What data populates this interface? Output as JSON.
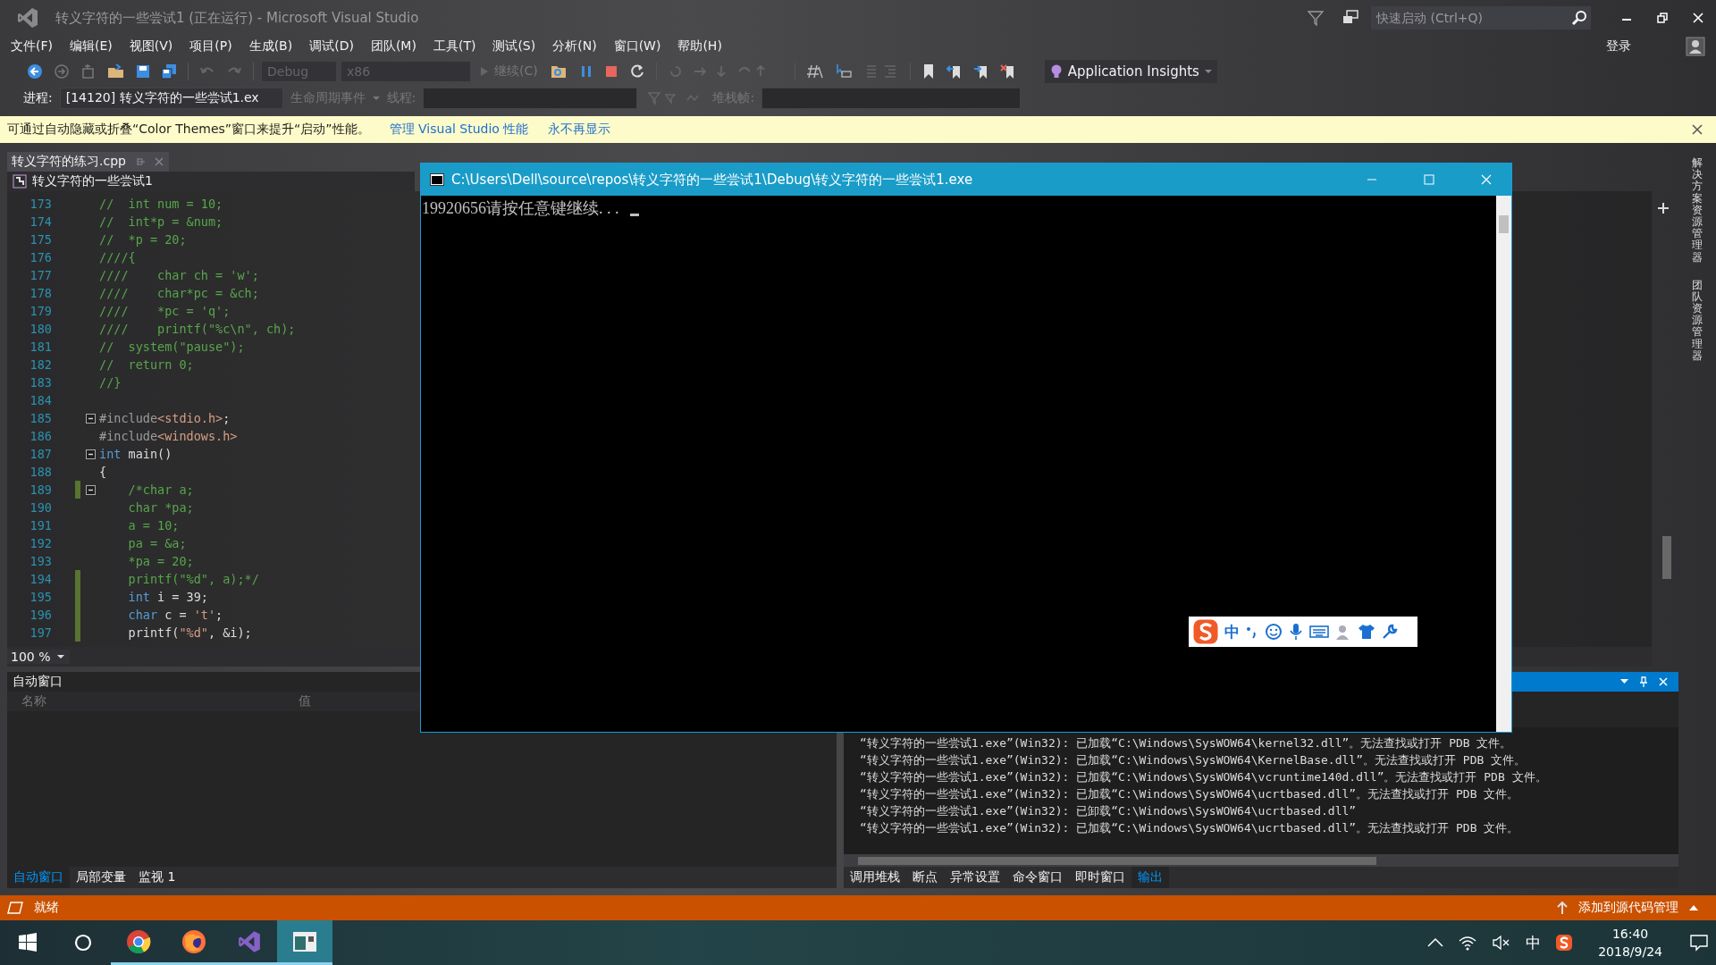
{
  "window": {
    "title": "转义字符的一些尝试1 (正在运行) - Microsoft Visual Studio"
  },
  "quick_launch": {
    "placeholder": "快速启动 (Ctrl+Q)"
  },
  "sign_in": "登录",
  "menu": [
    "文件(F)",
    "编辑(E)",
    "视图(V)",
    "项目(P)",
    "生成(B)",
    "调试(D)",
    "团队(M)",
    "工具(T)",
    "测试(S)",
    "分析(N)",
    "窗口(W)",
    "帮助(H)"
  ],
  "toolbar": {
    "configuration": "Debug",
    "platform": "x86",
    "continue": "继续(C)",
    "app_insights": "Application Insights"
  },
  "debug_bar": {
    "process_label": "进程:",
    "process": "[14120] 转义字符的一些尝试1.ex",
    "lifecycle": "生命周期事件",
    "thread_label": "线程:",
    "stack_label": "堆栈帧:"
  },
  "info_bar": {
    "message": "可通过自动隐藏或折叠“Color Themes”窗口来提升“启动”性能。",
    "links": [
      "管理 Visual Studio 性能",
      "永不再显示"
    ]
  },
  "editor": {
    "tabs": [
      {
        "label": "转义字符的练习.cpp",
        "selected": true
      }
    ],
    "project": "转义字符的一些尝试1",
    "zoom": "100 %",
    "lines": [
      {
        "number": "173",
        "fold": false,
        "changed": false,
        "segments": [
          {
            "kind": "comment",
            "text": "//  int num = 10;"
          }
        ]
      },
      {
        "number": "174",
        "fold": false,
        "changed": false,
        "segments": [
          {
            "kind": "comment",
            "text": "//  int*p = &num;"
          }
        ]
      },
      {
        "number": "175",
        "fold": false,
        "changed": false,
        "segments": [
          {
            "kind": "comment",
            "text": "//  *p = 20;"
          }
        ]
      },
      {
        "number": "176",
        "fold": false,
        "changed": false,
        "segments": [
          {
            "kind": "comment",
            "text": "////{"
          }
        ]
      },
      {
        "number": "177",
        "fold": false,
        "changed": false,
        "segments": [
          {
            "kind": "comment",
            "text": "////    char ch = 'w';"
          }
        ]
      },
      {
        "number": "178",
        "fold": false,
        "changed": false,
        "segments": [
          {
            "kind": "comment",
            "text": "////    char*pc = &ch;"
          }
        ]
      },
      {
        "number": "179",
        "fold": false,
        "changed": false,
        "segments": [
          {
            "kind": "comment",
            "text": "////    *pc = 'q';"
          }
        ]
      },
      {
        "number": "180",
        "fold": false,
        "changed": false,
        "segments": [
          {
            "kind": "comment",
            "text": "////    printf(\"%c\\n\", ch);"
          }
        ]
      },
      {
        "number": "181",
        "fold": false,
        "changed": false,
        "segments": [
          {
            "kind": "comment",
            "text": "//  system(\"pause\");"
          }
        ]
      },
      {
        "number": "182",
        "fold": false,
        "changed": false,
        "segments": [
          {
            "kind": "comment",
            "text": "//  return 0;"
          }
        ]
      },
      {
        "number": "183",
        "fold": false,
        "changed": false,
        "segments": [
          {
            "kind": "comment",
            "text": "//}"
          }
        ]
      },
      {
        "number": "184",
        "fold": false,
        "changed": false
      },
      {
        "number": "185",
        "fold": true,
        "changed": false,
        "segments": [
          {
            "kind": "preproc",
            "text": "#include"
          },
          {
            "kind": "string",
            "text": "<stdio.h>"
          },
          {
            "kind": "plain",
            "text": ";"
          }
        ]
      },
      {
        "number": "186",
        "fold": false,
        "changed": false,
        "segments": [
          {
            "kind": "preproc",
            "text": "#include"
          },
          {
            "kind": "string",
            "text": "<windows.h>"
          }
        ]
      },
      {
        "number": "187",
        "fold": true,
        "changed": false,
        "segments": [
          {
            "kind": "keyword",
            "text": "int"
          },
          {
            "kind": "plain",
            "text": " main()"
          }
        ]
      },
      {
        "number": "188",
        "fold": false,
        "changed": false,
        "segments": [
          {
            "kind": "plain",
            "text": "{"
          }
        ]
      },
      {
        "number": "189",
        "fold": true,
        "changed": true,
        "segments": [
          {
            "kind": "comment",
            "text": "    /*char a;"
          }
        ]
      },
      {
        "number": "190",
        "fold": false,
        "changed": false,
        "segments": [
          {
            "kind": "comment",
            "text": "    char *pa;"
          }
        ]
      },
      {
        "number": "191",
        "fold": false,
        "changed": false,
        "segments": [
          {
            "kind": "comment",
            "text": "    a = 10;"
          }
        ]
      },
      {
        "number": "192",
        "fold": false,
        "changed": false,
        "segments": [
          {
            "kind": "comment",
            "text": "    pa = &a;"
          }
        ]
      },
      {
        "number": "193",
        "fold": false,
        "changed": false,
        "segments": [
          {
            "kind": "comment",
            "text": "    *pa = 20;"
          }
        ]
      },
      {
        "number": "194",
        "fold": false,
        "changed": true,
        "segments": [
          {
            "kind": "comment",
            "text": "    printf(\"%d\", a);*/"
          }
        ]
      },
      {
        "number": "195",
        "fold": false,
        "changed": true,
        "segments": [
          {
            "kind": "keyword",
            "text": "    int"
          },
          {
            "kind": "plain",
            "text": " i = 39;"
          }
        ]
      },
      {
        "number": "196",
        "fold": false,
        "changed": true,
        "segments": [
          {
            "kind": "keyword",
            "text": "    char"
          },
          {
            "kind": "plain",
            "text": " c = "
          },
          {
            "kind": "string",
            "text": "'t'"
          },
          {
            "kind": "plain",
            "text": ";"
          }
        ]
      },
      {
        "number": "197",
        "fold": false,
        "changed": true,
        "segments": [
          {
            "kind": "plain",
            "text": "    printf("
          },
          {
            "kind": "string",
            "text": "\"%d\""
          },
          {
            "kind": "plain",
            "text": ", &i);"
          }
        ]
      }
    ]
  },
  "side_tabs": [
    "解决方案资源管理器",
    "团队资源管理器"
  ],
  "auto_window": {
    "title": "自动窗口",
    "columns": [
      "名称",
      "值"
    ],
    "tabs": [
      {
        "label": "自动窗口",
        "selected": true
      },
      {
        "label": "局部变量",
        "selected": false
      },
      {
        "label": "监视 1",
        "selected": false
      }
    ]
  },
  "output": {
    "lines": [
      "“转义字符的一些尝试1.exe”(Win32): 已加载“C:\\Windows\\SysWOW64\\kernel32.dll”。无法查找或打开 PDB 文件。",
      "“转义字符的一些尝试1.exe”(Win32): 已加载“C:\\Windows\\SysWOW64\\KernelBase.dll”。无法查找或打开 PDB 文件。",
      "“转义字符的一些尝试1.exe”(Win32): 已加载“C:\\Windows\\SysWOW64\\vcruntime140d.dll”。无法查找或打开 PDB 文件。",
      "“转义字符的一些尝试1.exe”(Win32): 已加载“C:\\Windows\\SysWOW64\\ucrtbased.dll”。无法查找或打开 PDB 文件。",
      "“转义字符的一些尝试1.exe”(Win32): 已卸载“C:\\Windows\\SysWOW64\\ucrtbased.dll”",
      "“转义字符的一些尝试1.exe”(Win32): 已加载“C:\\Windows\\SysWOW64\\ucrtbased.dll”。无法查找或打开 PDB 文件。"
    ],
    "tabs": [
      {
        "label": "调用堆栈",
        "selected": false
      },
      {
        "label": "断点",
        "selected": false
      },
      {
        "label": "异常设置",
        "selected": false
      },
      {
        "label": "命令窗口",
        "selected": false
      },
      {
        "label": "即时窗口",
        "selected": false
      },
      {
        "label": "输出",
        "selected": true
      }
    ]
  },
  "status_bar": {
    "state": "就绪",
    "source_control": "添加到源代码管理"
  },
  "console": {
    "title": "C:\\Users\\Dell\\source\\repos\\转义字符的一些尝试1\\Debug\\转义字符的一些尝试1.exe",
    "text": "19920656请按任意键继续. . ."
  },
  "ime_bar": {
    "mode": "中"
  },
  "taskbar": {
    "apps": [
      {
        "kind": "chrome",
        "selected": false
      },
      {
        "kind": "firefox",
        "selected": false
      },
      {
        "kind": "vs",
        "selected": false
      },
      {
        "kind": "console",
        "selected": true
      }
    ],
    "ime": "中",
    "time": "16:40",
    "date": "2018/9/24"
  }
}
